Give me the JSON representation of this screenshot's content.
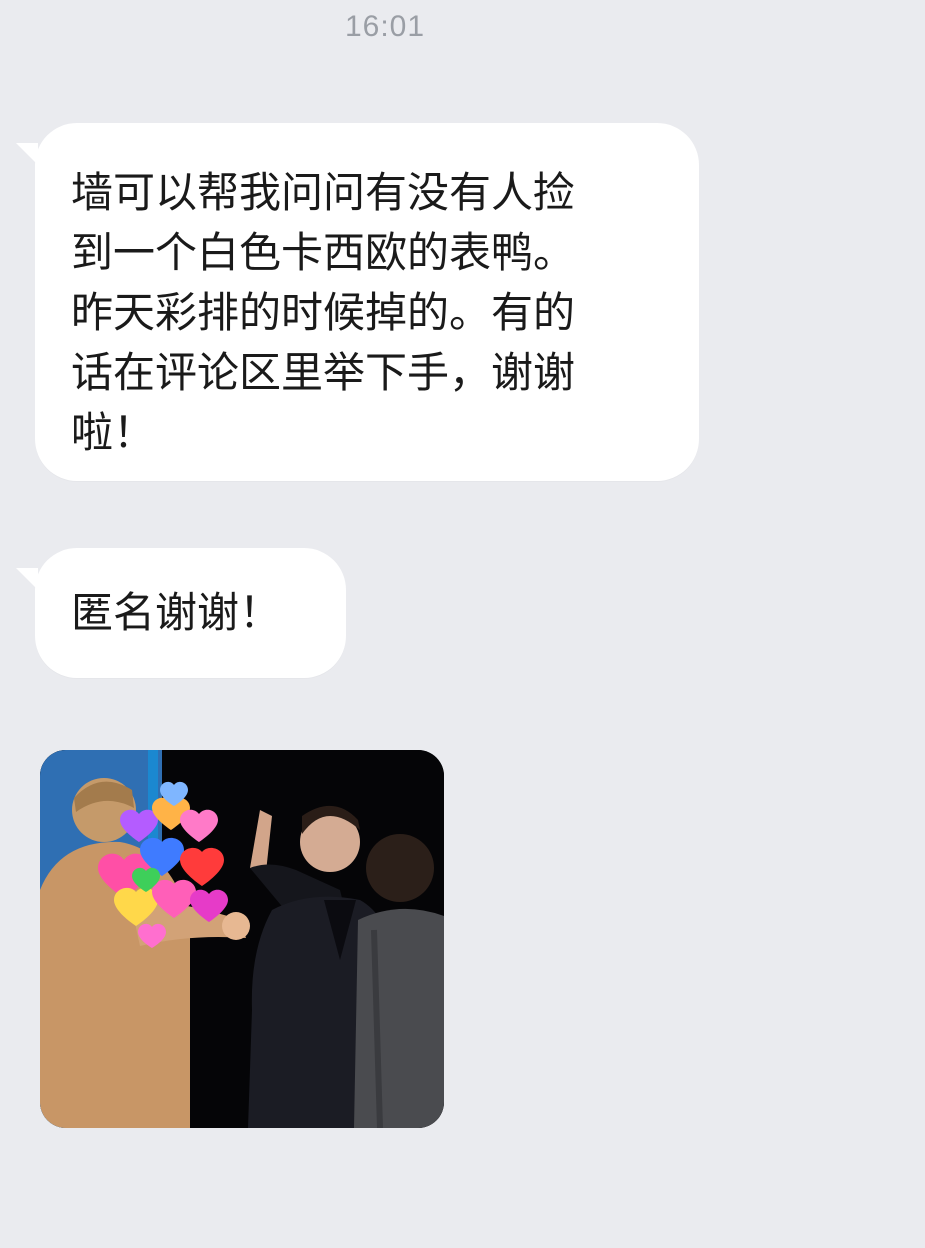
{
  "chat": {
    "timestamp": "16:01",
    "messages": [
      {
        "type": "text",
        "text": "墙可以帮我问问有没有人捡\n到一个白色卡西欧的表鸭。\n昨天彩排的时候掉的。有的\n话在评论区里举下手，谢谢\n啦！"
      },
      {
        "type": "text",
        "text": "匿名谢谢！"
      },
      {
        "type": "image",
        "icon": "meme-image"
      }
    ]
  },
  "colors": {
    "background": "#eaebef",
    "bubble": "#ffffff",
    "text": "#1a1a1a",
    "timestamp": "#9a9ea5"
  }
}
